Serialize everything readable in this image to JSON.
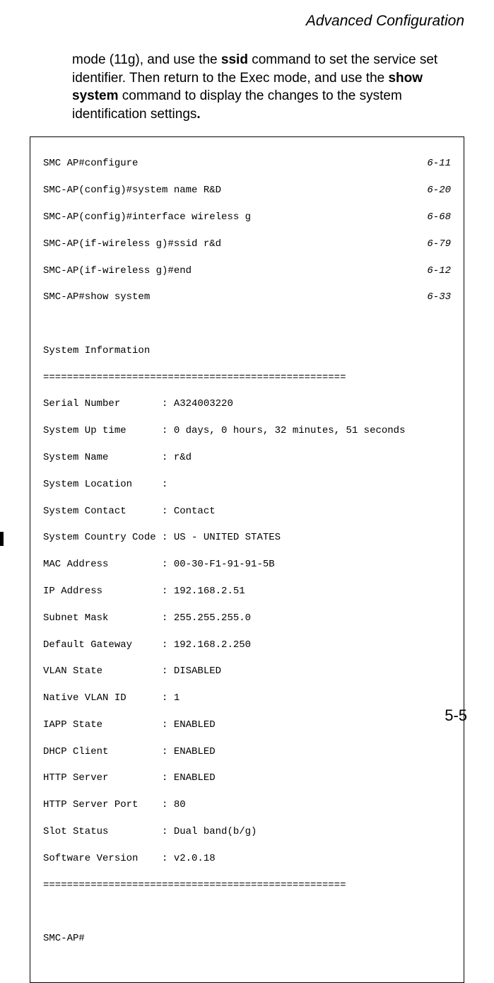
{
  "header": {
    "title": "Advanced Configuration"
  },
  "paragraph": {
    "p1a": "mode (11g), and use the ",
    "p1b_bold": "ssid",
    "p1c": " command to set the service set identifier. Then return to the Exec mode, and use the ",
    "p1d_bold": "show system",
    "p1e": " command to display the changes to the system identification settings",
    "p1f_bold": "."
  },
  "code": {
    "lines": [
      {
        "text": "SMC AP#configure",
        "ref": "6-11"
      },
      {
        "text": "SMC-AP(config)#system name R&D",
        "ref": "6-20"
      },
      {
        "text": "SMC-AP(config)#interface wireless g",
        "ref": "6-68"
      },
      {
        "text": "SMC-AP(if-wireless g)#ssid r&d",
        "ref": "6-79"
      },
      {
        "text": "SMC-AP(if-wireless g)#end",
        "ref": "6-12"
      },
      {
        "text": "SMC-AP#show system",
        "ref": "6-33"
      }
    ],
    "blank1": "",
    "info_header": "System Information",
    "sep1": "===================================================",
    "rows": [
      "Serial Number       : A324003220",
      "System Up time      : 0 days, 0 hours, 32 minutes, 51 seconds",
      "System Name         : r&d",
      "System Location     :",
      "System Contact      : Contact",
      "System Country Code : US - UNITED STATES",
      "MAC Address         : 00-30-F1-91-91-5B",
      "IP Address          : 192.168.2.51",
      "Subnet Mask         : 255.255.255.0",
      "Default Gateway     : 192.168.2.250",
      "VLAN State          : DISABLED",
      "Native VLAN ID      : 1",
      "IAPP State          : ENABLED",
      "DHCP Client         : ENABLED",
      "HTTP Server         : ENABLED",
      "HTTP Server Port    : 80",
      "Slot Status         : Dual band(b/g)",
      "Software Version    : v2.0.18"
    ],
    "sep2": "===================================================",
    "blank2": "",
    "prompt": "SMC-AP#"
  },
  "page_number": "5-5"
}
